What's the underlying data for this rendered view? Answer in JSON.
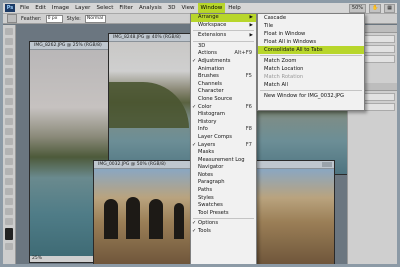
{
  "menubar": {
    "logo": "Ps",
    "items": [
      "File",
      "Edit",
      "Image",
      "Layer",
      "Select",
      "Filter",
      "Analysis",
      "3D",
      "View",
      "Window",
      "Help"
    ],
    "zoom": "50%"
  },
  "optbar": {
    "feather_label": "Feather:",
    "feather_value": "0 px",
    "style_label": "Style:",
    "style_value": "Normal"
  },
  "docs": {
    "doc1": {
      "title": "IMG_8262.JPG @ 25% (RGB/8)",
      "zoom": "25%"
    },
    "doc2": {
      "title": "IMG_8248.JPG @ 40% (RGB/8)"
    },
    "doc3": {
      "title": "IMG_0032.JPG @ 50% (RGB/8)"
    }
  },
  "window_menu": {
    "items": [
      {
        "label": "Arrange",
        "arrow": "▶",
        "hl": true
      },
      {
        "label": "Workspace",
        "arrow": "▶"
      },
      {
        "sep": true
      },
      {
        "label": "Extensions",
        "arrow": "▶"
      },
      {
        "sep": true
      },
      {
        "label": "3D"
      },
      {
        "label": "Actions",
        "sc": "Alt+F9"
      },
      {
        "label": "Adjustments",
        "chk": "✓"
      },
      {
        "label": "Animation"
      },
      {
        "label": "Brushes",
        "sc": "F5"
      },
      {
        "label": "Channels"
      },
      {
        "label": "Character"
      },
      {
        "label": "Clone Source"
      },
      {
        "label": "Color",
        "chk": "✓",
        "sc": "F6"
      },
      {
        "label": "Histogram"
      },
      {
        "label": "History"
      },
      {
        "label": "Info",
        "sc": "F8"
      },
      {
        "label": "Layer Comps"
      },
      {
        "label": "Layers",
        "chk": "✓",
        "sc": "F7"
      },
      {
        "label": "Masks"
      },
      {
        "label": "Measurement Log"
      },
      {
        "label": "Navigator"
      },
      {
        "label": "Notes"
      },
      {
        "label": "Paragraph"
      },
      {
        "label": "Paths"
      },
      {
        "label": "Styles"
      },
      {
        "label": "Swatches"
      },
      {
        "label": "Tool Presets"
      },
      {
        "sep": true
      },
      {
        "label": "Options",
        "chk": "✓"
      },
      {
        "label": "Tools",
        "chk": "✓"
      }
    ]
  },
  "arrange_submenu": {
    "items": [
      {
        "label": "Cascade"
      },
      {
        "label": "Tile"
      },
      {
        "label": "Float in Window"
      },
      {
        "label": "Float All in Windows"
      },
      {
        "label": "Consolidate All to Tabs",
        "hl": true
      },
      {
        "sep": true
      },
      {
        "label": "Match Zoom"
      },
      {
        "label": "Match Location"
      },
      {
        "label": "Match Rotation",
        "dis": true
      },
      {
        "label": "Match All"
      },
      {
        "sep": true
      },
      {
        "label": "New Window for IMG_0032.JPG"
      }
    ]
  }
}
